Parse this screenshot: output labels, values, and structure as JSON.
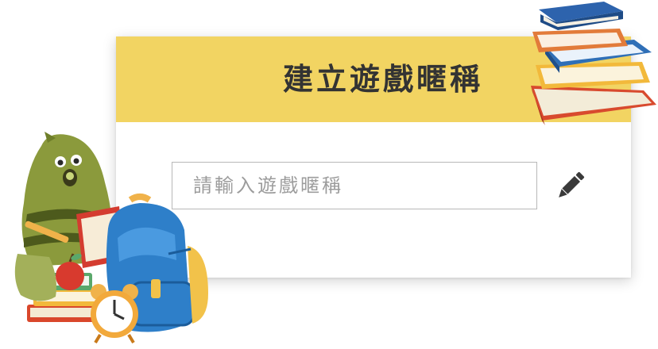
{
  "dialog": {
    "title": "建立遊戲暱稱",
    "nickname_input": {
      "value": "",
      "placeholder": "請輸入遊戲暱稱"
    },
    "edit_icon": "pencil-icon"
  },
  "decorations": {
    "top_right": "book-stack-illustration",
    "bottom_left": "mascot-with-backpack-and-alarm-clock"
  },
  "colors": {
    "header_bg": "#f2d462",
    "title_text": "#333333",
    "icon": "#3a3a3a"
  }
}
